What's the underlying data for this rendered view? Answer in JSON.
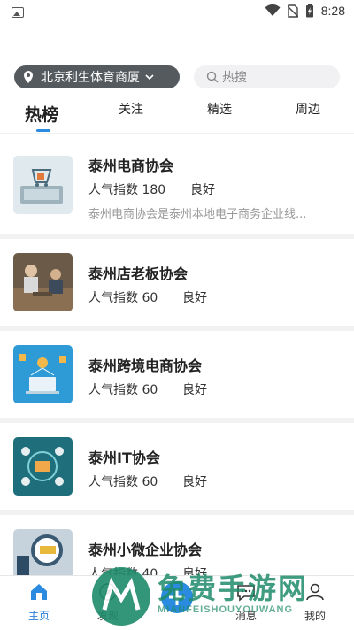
{
  "status_bar": {
    "time": "8:28",
    "icons": [
      "image-icon",
      "wifi-icon",
      "no-sim-icon",
      "battery-charging-icon"
    ]
  },
  "header": {
    "location": "北京利生体育商厦",
    "search_placeholder": "热搜"
  },
  "tabs": [
    {
      "label": "热榜",
      "active": true
    },
    {
      "label": "关注",
      "active": false
    },
    {
      "label": "精选",
      "active": false
    },
    {
      "label": "周边",
      "active": false
    }
  ],
  "list": [
    {
      "title": "泰州电商协会",
      "popularity": "人气指数 180",
      "status": "良好",
      "description": "泰州电商协会是泰州本地电子商务企业线..."
    },
    {
      "title": "泰州店老板协会",
      "popularity": "人气指数 60",
      "status": "良好",
      "description": ""
    },
    {
      "title": "泰州跨境电商协会",
      "popularity": "人气指数 60",
      "status": "良好",
      "description": ""
    },
    {
      "title": "泰州IT协会",
      "popularity": "人气指数 60",
      "status": "良好",
      "description": ""
    },
    {
      "title": "泰州小微企业协会",
      "popularity": "人气指数 40",
      "status": "良好",
      "description": ""
    }
  ],
  "bottom_nav": [
    {
      "label": "主页",
      "icon": "home-icon",
      "active": true
    },
    {
      "label": "发现",
      "icon": "discover-icon",
      "active": false
    },
    {
      "label": "",
      "icon": "add-icon",
      "active": false
    },
    {
      "label": "消息",
      "icon": "message-icon",
      "active": false
    },
    {
      "label": "我的",
      "icon": "profile-icon",
      "active": false
    }
  ],
  "watermark": {
    "text": "免费手游网",
    "subtext": "MIANFEISHOUYOUWANG"
  },
  "colors": {
    "accent": "#2a8be0",
    "pill": "#555a5e",
    "watermark": "#1f8b6a"
  }
}
